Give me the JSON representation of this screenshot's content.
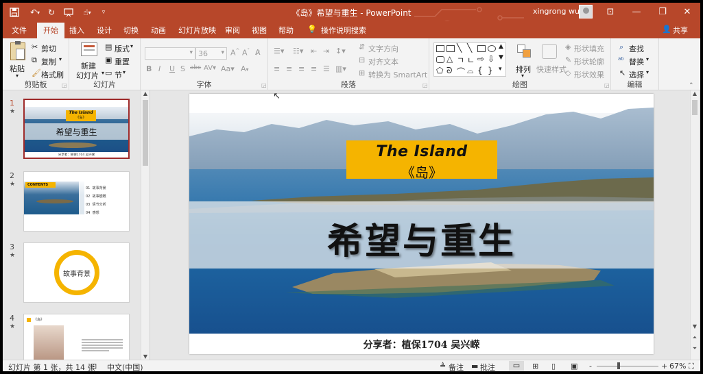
{
  "app": {
    "title": "《岛》希望与重生 - PowerPoint",
    "user": "xingrong wu"
  },
  "window_controls": {
    "ribbon_display": "⊡",
    "minimize": "—",
    "restore": "❐",
    "close": "✕"
  },
  "tabs": [
    {
      "label": "文件"
    },
    {
      "label": "开始",
      "active": true
    },
    {
      "label": "插入"
    },
    {
      "label": "设计"
    },
    {
      "label": "切换"
    },
    {
      "label": "动画"
    },
    {
      "label": "幻灯片放映"
    },
    {
      "label": "审阅"
    },
    {
      "label": "视图"
    },
    {
      "label": "帮助"
    },
    {
      "label": "操作说明搜索"
    }
  ],
  "share": "共享",
  "ribbon": {
    "clipboard": {
      "label": "剪贴板",
      "paste": "粘贴",
      "cut": "剪切",
      "copy": "复制",
      "format_painter": "格式刷"
    },
    "slides": {
      "label": "幻灯片",
      "new_slide_1": "新建",
      "new_slide_2": "幻灯片",
      "layout": "版式",
      "reset": "重置",
      "section": "节"
    },
    "font": {
      "label": "字体",
      "font_size": "36"
    },
    "paragraph": {
      "label": "段落",
      "text_direction": "文字方向",
      "align_text": "对齐文本",
      "smartart": "转换为 SmartArt"
    },
    "drawing": {
      "label": "绘图",
      "arrange": "排列",
      "quick_styles": "快速样式",
      "shape_fill": "形状填充",
      "shape_outline": "形状轮廓",
      "shape_effects": "形状效果"
    },
    "editing": {
      "label": "编辑",
      "find": "查找",
      "replace": "替换",
      "select": "选择"
    }
  },
  "thumbnails": [
    {
      "num": "1",
      "title_en": "The Island",
      "title_cn": "《岛》",
      "main": "希望与重生",
      "footer": "分享者：植保1704 吴兴嵘"
    },
    {
      "num": "2",
      "contents": "CONTENTS",
      "items": [
        {
          "n": "01",
          "t": "故事背景"
        },
        {
          "n": "02",
          "t": "故事梗概"
        },
        {
          "n": "03",
          "t": "情节分析"
        },
        {
          "n": "04",
          "t": "感想"
        }
      ]
    },
    {
      "num": "3",
      "circle_text": "故事背景"
    },
    {
      "num": "4",
      "header": "《岛》"
    }
  ],
  "slide": {
    "title_en": "The Island",
    "title_cn": "《岛》",
    "main_title": "希望与重生",
    "presenter": "分享者：植保1704 吴兴嵘"
  },
  "status": {
    "slide_info": "幻灯片 第 1 张，共 14 张",
    "language": "中文(中国)",
    "notes": "备注",
    "comments": "批注",
    "zoom_minus": "-",
    "zoom_plus": "+",
    "zoom": "67%"
  },
  "colors": {
    "accent": "#b7472a",
    "highlight": "#f5b400"
  }
}
